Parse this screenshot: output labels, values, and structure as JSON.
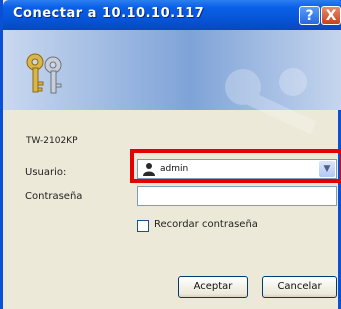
{
  "window": {
    "title": "Conectar a 10.10.10.117",
    "help_symbol": "?",
    "close_symbol": "X"
  },
  "banner": {
    "icon": "keys-icon"
  },
  "server_label": "TW-2102KP",
  "username": {
    "label": "Usuario:",
    "value": "admin"
  },
  "password": {
    "label": "Contraseña",
    "value": ""
  },
  "remember": {
    "label": "Recordar contraseña",
    "checked": false
  },
  "buttons": {
    "ok": "Aceptar",
    "cancel": "Cancelar"
  },
  "colors": {
    "titlebar": "#0653d4",
    "highlight": "#e30000",
    "dialog_bg": "#ece9d8"
  }
}
